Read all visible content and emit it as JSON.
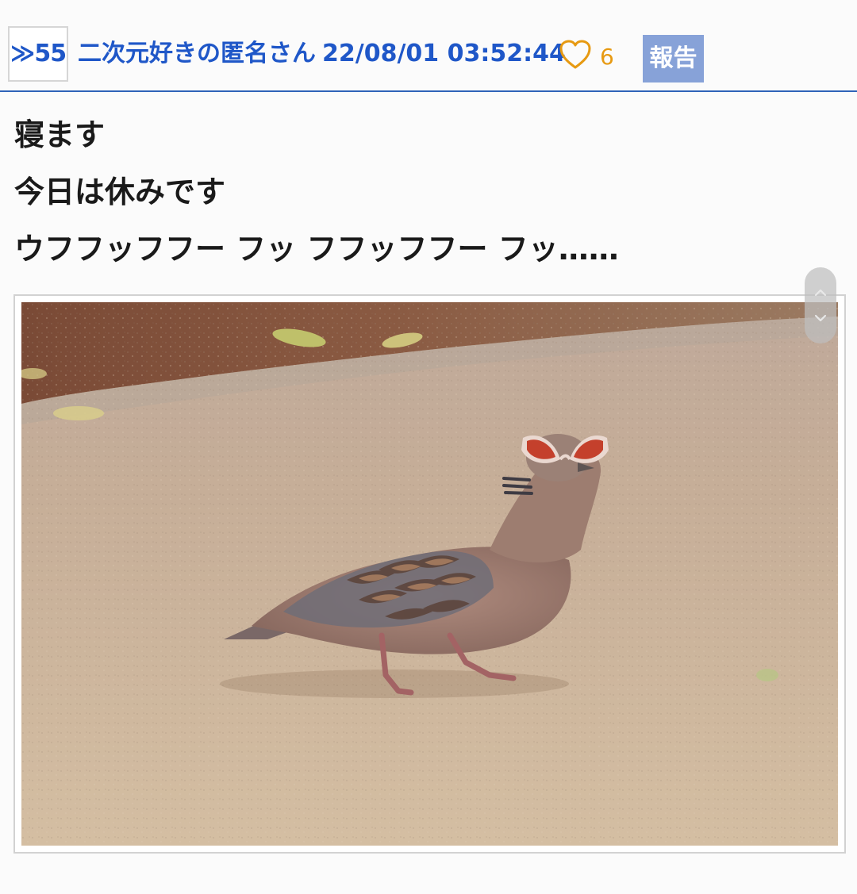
{
  "post": {
    "res_number": "≫55",
    "author": "二次元好きの匿名さん",
    "timestamp": "22/08/01 03:52:44",
    "like_count": "6",
    "report_label": "報告",
    "body_lines": [
      "寝ます",
      "今日は休みです",
      "ウフフッフフー フッ フフッフフー フッ……"
    ]
  },
  "colors": {
    "link_blue": "#1f57c8",
    "divider_blue": "#2f63b8",
    "report_bg": "#87a2d8",
    "heart_orange": "#e79a12"
  },
  "icons": {
    "like": "heart-outline-icon",
    "scroll_up": "chevron-up-icon",
    "scroll_down": "chevron-down-icon"
  }
}
